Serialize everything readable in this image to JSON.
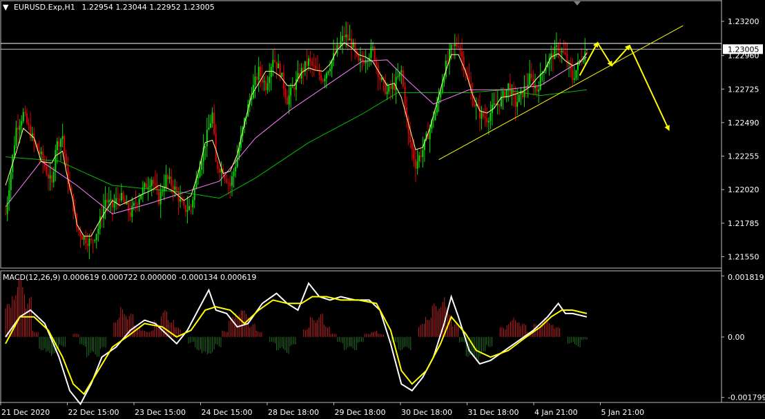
{
  "header": {
    "triangle": "▼",
    "symbol": "EURUSD.Exp,H1",
    "ohlc": "1.22954 1.23044 1.22952 1.23005"
  },
  "macd_header": "MACD(12,26,9) 0.000619 0.000722 0.000000 -0.000134 0.000619",
  "colors": {
    "bg": "#000000",
    "bull": "#00e000",
    "bear": "#e00000",
    "grid": "#ffffff",
    "annotation": "#ffff00",
    "ma_slow": "#00c000",
    "ma_mid": "#ff80ff",
    "ma_fast": "#ffff99",
    "macd_main": "#ffffff",
    "macd_signal": "#ffff00"
  },
  "chart_data": [
    {
      "type": "candlestick",
      "title": "EURUSD.Exp,H1",
      "yaxis_ticks": [
        "1.23200",
        "1.22960",
        "1.22725",
        "1.22490",
        "1.22255",
        "1.22020",
        "1.21785",
        "1.21550"
      ],
      "ylim": [
        1.2147,
        1.2334
      ],
      "current_price_label": "1.23005",
      "current_price": 1.23005,
      "resistance_level": 1.23045,
      "xaxis_ticks": [
        "21 Dec 2020",
        "22 Dec 15:00",
        "23 Dec 15:00",
        "24 Dec 15:00",
        "28 Dec 18:00",
        "29 Dec 18:00",
        "30 Dec 18:00",
        "31 Dec 18:00",
        "4 Jan 21:00",
        "5 Jan 21:00"
      ],
      "price_path": [
        [
          0,
          1.2185
        ],
        [
          6,
          1.2245
        ],
        [
          10,
          1.2255
        ],
        [
          16,
          1.2235
        ],
        [
          20,
          1.2225
        ],
        [
          26,
          1.2205
        ],
        [
          28,
          1.2232
        ],
        [
          32,
          1.224
        ],
        [
          34,
          1.2215
        ],
        [
          38,
          1.219
        ],
        [
          40,
          1.2175
        ],
        [
          44,
          1.2168
        ],
        [
          48,
          1.2165
        ],
        [
          52,
          1.2175
        ],
        [
          56,
          1.2195
        ],
        [
          60,
          1.219
        ],
        [
          64,
          1.2198
        ],
        [
          70,
          1.2185
        ],
        [
          76,
          1.22
        ],
        [
          82,
          1.221
        ],
        [
          86,
          1.2195
        ],
        [
          90,
          1.221
        ],
        [
          94,
          1.2205
        ],
        [
          100,
          1.2188
        ],
        [
          104,
          1.219
        ],
        [
          108,
          1.2215
        ],
        [
          112,
          1.2235
        ],
        [
          116,
          1.2255
        ],
        [
          118,
          1.222
        ],
        [
          122,
          1.2215
        ],
        [
          126,
          1.2205
        ],
        [
          130,
          1.2225
        ],
        [
          134,
          1.225
        ],
        [
          138,
          1.227
        ],
        [
          142,
          1.2285
        ],
        [
          146,
          1.2275
        ],
        [
          150,
          1.2295
        ],
        [
          154,
          1.2285
        ],
        [
          158,
          1.2265
        ],
        [
          162,
          1.2275
        ],
        [
          166,
          1.2285
        ],
        [
          170,
          1.2292
        ],
        [
          174,
          1.2285
        ],
        [
          178,
          1.228
        ],
        [
          182,
          1.229
        ],
        [
          186,
          1.23
        ],
        [
          190,
          1.231
        ],
        [
          194,
          1.2305
        ],
        [
          198,
          1.229
        ],
        [
          202,
          1.2295
        ],
        [
          206,
          1.23
        ],
        [
          210,
          1.228
        ],
        [
          214,
          1.227
        ],
        [
          218,
          1.2275
        ],
        [
          222,
          1.2285
        ],
        [
          226,
          1.224
        ],
        [
          230,
          1.222
        ],
        [
          234,
          1.223
        ],
        [
          238,
          1.2245
        ],
        [
          242,
          1.226
        ],
        [
          246,
          1.2285
        ],
        [
          250,
          1.23
        ],
        [
          254,
          1.2305
        ],
        [
          258,
          1.2285
        ],
        [
          262,
          1.2265
        ],
        [
          266,
          1.2255
        ],
        [
          270,
          1.2252
        ],
        [
          274,
          1.226
        ],
        [
          278,
          1.2265
        ],
        [
          282,
          1.2275
        ],
        [
          286,
          1.2262
        ],
        [
          290,
          1.227
        ],
        [
          294,
          1.228
        ],
        [
          298,
          1.2272
        ],
        [
          302,
          1.2288
        ],
        [
          306,
          1.2295
        ],
        [
          310,
          1.2302
        ],
        [
          314,
          1.2295
        ],
        [
          318,
          1.228
        ],
        [
          322,
          1.2292
        ],
        [
          326,
          1.23005
        ]
      ],
      "moving_averages": {
        "slow": [
          [
            0,
            1.2225
          ],
          [
            30,
            1.2222
          ],
          [
            60,
            1.2205
          ],
          [
            100,
            1.22
          ],
          [
            120,
            1.2196
          ],
          [
            140,
            1.221
          ],
          [
            170,
            1.2235
          ],
          [
            200,
            1.2255
          ],
          [
            220,
            1.227
          ],
          [
            240,
            1.227
          ],
          [
            260,
            1.227
          ],
          [
            280,
            1.2272
          ],
          [
            300,
            1.2268
          ],
          [
            326,
            1.2272
          ]
        ],
        "mid": [
          [
            0,
            1.219
          ],
          [
            20,
            1.2222
          ],
          [
            40,
            1.2205
          ],
          [
            60,
            1.2185
          ],
          [
            80,
            1.2192
          ],
          [
            100,
            1.22
          ],
          [
            120,
            1.2208
          ],
          [
            140,
            1.2238
          ],
          [
            160,
            1.2258
          ],
          [
            180,
            1.2275
          ],
          [
            200,
            1.2292
          ],
          [
            214,
            1.2293
          ],
          [
            226,
            1.2278
          ],
          [
            240,
            1.2262
          ],
          [
            260,
            1.2272
          ],
          [
            280,
            1.2272
          ],
          [
            300,
            1.2275
          ],
          [
            326,
            1.2295
          ]
        ]
      },
      "annotations": {
        "trendline": [
          [
            243,
            1.2223
          ],
          [
            380,
            1.2317
          ]
        ],
        "arrows": [
          [
            [
              322,
              1.2282
            ],
            [
              332,
              1.2305
            ]
          ],
          [
            [
              332,
              1.2305
            ],
            [
              340,
              1.2289
            ]
          ],
          [
            [
              340,
              1.2289
            ],
            [
              350,
              1.2303
            ]
          ],
          [
            [
              350,
              1.2303
            ],
            [
              372,
              1.2244
            ]
          ]
        ]
      }
    },
    {
      "type": "macd",
      "title": "MACD(12,26,9)",
      "yaxis_ticks": [
        "0.001819",
        "0.00",
        "-0.001799"
      ],
      "ylim": [
        -0.00195,
        0.00195
      ],
      "histogram": [
        0.001,
        0.0016,
        0.0018,
        0.0012,
        0.0002,
        -0.0004,
        -0.0006,
        -0.0005,
        -0.0003,
        0.0,
        0.0001,
        -0.0003,
        -0.0006,
        -0.0006,
        -0.0004,
        0.0,
        0.0006,
        0.0009,
        0.0007,
        0.0004,
        0.0002,
        0.0002,
        0.0005,
        0.0008,
        0.0006,
        0.0003,
        0.0,
        -0.0002,
        -0.0004,
        -0.0006,
        -0.0005,
        -0.0003,
        0.0002,
        0.0006,
        0.0009,
        0.0008,
        0.0004,
        0.0002,
        0.0,
        -0.0002,
        -0.0004,
        -0.0005,
        -0.0003,
        0.0,
        0.0003,
        0.0006,
        0.0007,
        0.0004,
        0.0001,
        -0.0002,
        -0.0004,
        -0.0004,
        -0.0002,
        0.0001,
        0.0002,
        0.0001,
        0.0,
        -0.0002,
        -0.0004,
        -0.0004,
        0.0,
        0.0004,
        0.0007,
        0.001,
        0.0012,
        0.0009,
        0.0004,
        -0.0002,
        -0.0006,
        -0.0008,
        -0.0006,
        -0.0003,
        0.0,
        0.0003,
        0.0005,
        0.0006,
        0.0004,
        0.0002,
        0.0004,
        0.0006,
        0.0005,
        0.0003,
        0.0,
        -0.0002,
        -0.0003,
        -0.0001
      ],
      "macd": [
        [
          0,
          0.0
        ],
        [
          8,
          0.0006
        ],
        [
          14,
          0.0008
        ],
        [
          22,
          0.0004
        ],
        [
          30,
          -0.0006
        ],
        [
          36,
          -0.0016
        ],
        [
          42,
          -0.002
        ],
        [
          48,
          -0.0014
        ],
        [
          54,
          -0.0006
        ],
        [
          62,
          -0.0003
        ],
        [
          70,
          0.0002
        ],
        [
          78,
          0.0005
        ],
        [
          84,
          0.0004
        ],
        [
          90,
          0.0001
        ],
        [
          96,
          -0.0002
        ],
        [
          102,
          0.0002
        ],
        [
          108,
          0.0008
        ],
        [
          114,
          0.0014
        ],
        [
          118,
          0.0008
        ],
        [
          124,
          0.0007
        ],
        [
          130,
          0.0003
        ],
        [
          136,
          0.0004
        ],
        [
          144,
          0.001
        ],
        [
          152,
          0.0013
        ],
        [
          158,
          0.001
        ],
        [
          164,
          0.0008
        ],
        [
          170,
          0.0016
        ],
        [
          176,
          0.0012
        ],
        [
          182,
          0.0011
        ],
        [
          188,
          0.0012
        ],
        [
          196,
          0.0011
        ],
        [
          204,
          0.0011
        ],
        [
          210,
          0.0008
        ],
        [
          216,
          -0.0002
        ],
        [
          222,
          -0.0014
        ],
        [
          228,
          -0.0016
        ],
        [
          234,
          -0.0012
        ],
        [
          240,
          -0.0006
        ],
        [
          246,
          0.0004
        ],
        [
          250,
          0.0012
        ],
        [
          254,
          0.0006
        ],
        [
          260,
          -0.0004
        ],
        [
          266,
          -0.0008
        ],
        [
          272,
          -0.0007
        ],
        [
          280,
          -0.0004
        ],
        [
          288,
          -0.0001
        ],
        [
          296,
          0.0002
        ],
        [
          304,
          0.0006
        ],
        [
          310,
          0.001
        ],
        [
          314,
          0.0007
        ],
        [
          318,
          0.0007
        ],
        [
          326,
          0.0006
        ]
      ],
      "signal": [
        [
          0,
          -0.0002
        ],
        [
          8,
          0.0006
        ],
        [
          16,
          0.0006
        ],
        [
          24,
          0.0002
        ],
        [
          32,
          -0.0006
        ],
        [
          38,
          -0.0014
        ],
        [
          44,
          -0.0017
        ],
        [
          52,
          -0.001
        ],
        [
          60,
          -0.0003
        ],
        [
          68,
          0.0
        ],
        [
          78,
          0.0004
        ],
        [
          88,
          0.0003
        ],
        [
          96,
          0.0
        ],
        [
          104,
          0.0002
        ],
        [
          112,
          0.0008
        ],
        [
          118,
          0.0009
        ],
        [
          126,
          0.0008
        ],
        [
          134,
          0.0004
        ],
        [
          142,
          0.0008
        ],
        [
          150,
          0.0011
        ],
        [
          158,
          0.001
        ],
        [
          166,
          0.001
        ],
        [
          172,
          0.0012
        ],
        [
          180,
          0.0012
        ],
        [
          188,
          0.0011
        ],
        [
          198,
          0.0011
        ],
        [
          208,
          0.001
        ],
        [
          216,
          0.0002
        ],
        [
          222,
          -0.001
        ],
        [
          228,
          -0.0014
        ],
        [
          236,
          -0.001
        ],
        [
          244,
          -0.0002
        ],
        [
          250,
          0.0006
        ],
        [
          258,
          0.0001
        ],
        [
          264,
          -0.0004
        ],
        [
          272,
          -0.0006
        ],
        [
          282,
          -0.0004
        ],
        [
          292,
          0.0
        ],
        [
          300,
          0.0003
        ],
        [
          306,
          0.0006
        ],
        [
          312,
          0.0008
        ],
        [
          318,
          0.0008
        ],
        [
          326,
          0.0007
        ]
      ]
    }
  ]
}
